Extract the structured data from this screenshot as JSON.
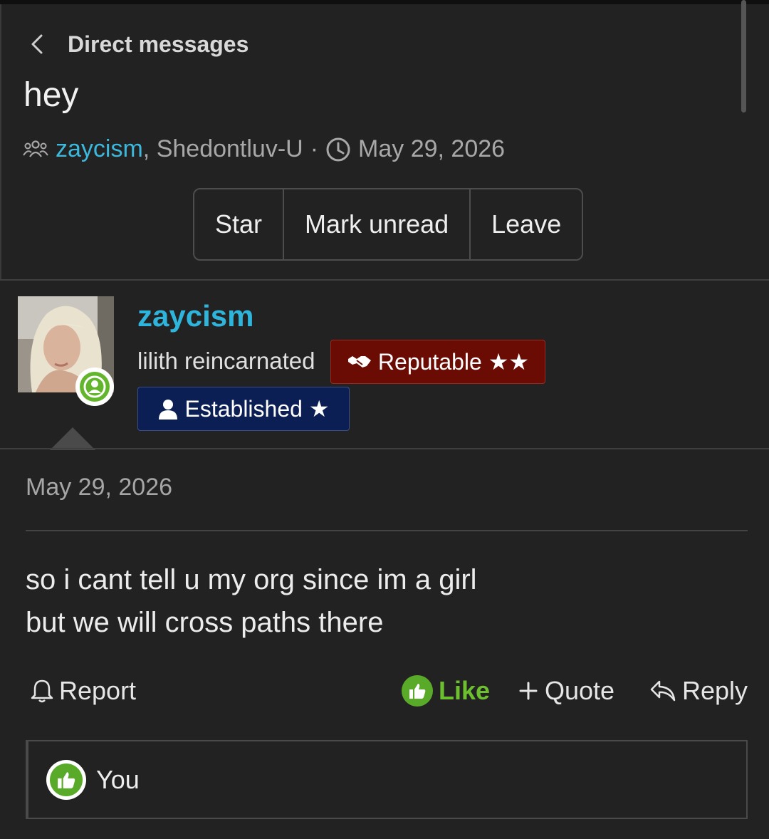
{
  "header": {
    "breadcrumb": "Direct messages",
    "title": "hey",
    "participants": [
      "zaycism",
      "Shedontluv-U"
    ],
    "separator": ",",
    "dot": "·",
    "date": "May 29, 2026"
  },
  "actions": [
    "Star",
    "Mark unread",
    "Leave"
  ],
  "post": {
    "author": "zaycism",
    "user_title": "lilith reincarnated",
    "badges": {
      "reputable": "Reputable ★★",
      "established": "Established ★"
    },
    "date": "May 29, 2026",
    "body_lines": [
      "so i cant tell u my org since im a girl",
      "but we will cross paths there"
    ],
    "controls": {
      "report": "Report",
      "like": "Like",
      "quote": "Quote",
      "reply": "Reply"
    },
    "likes_summary": "You"
  },
  "colors": {
    "background": "#222222",
    "link": "#2fb4dc",
    "like": "#6cbf2f",
    "reputable_badge": "#6a0c04",
    "established_badge": "#0b1f55"
  }
}
